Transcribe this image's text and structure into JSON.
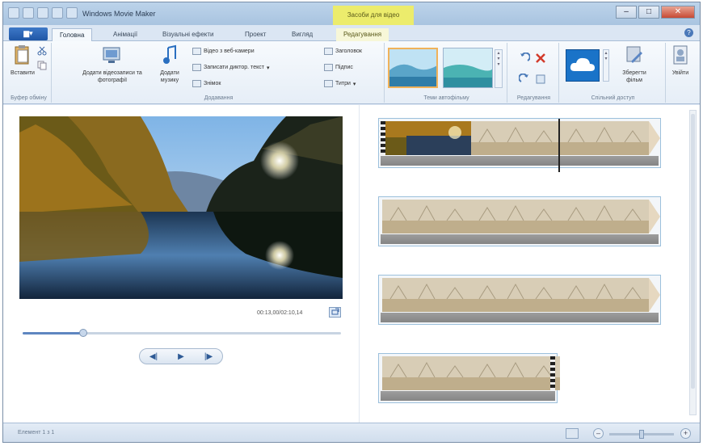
{
  "window": {
    "title": "Windows Movie Maker",
    "context_tab_header": "Засоби для відео",
    "controls": {
      "minimize": "–",
      "maximize": "□",
      "close": "✕"
    }
  },
  "tabs": {
    "file_label": "",
    "items": [
      {
        "label": "Головна",
        "active": true
      },
      {
        "label": "Анімації"
      },
      {
        "label": "Візуальні ефекти"
      },
      {
        "label": "Проект"
      },
      {
        "label": "Вигляд"
      },
      {
        "label": "Редагування",
        "contextual": true
      }
    ],
    "help": "?"
  },
  "ribbon": {
    "clipboard": {
      "paste_label": "Вставити",
      "group_label": "Буфер обміну"
    },
    "add": {
      "add_media_label": "Додати відеозаписи та фотографії",
      "add_music_label": "Додати музику",
      "webcam_label": "Відео з веб-камери",
      "narration_label": "Записати диктор. текст",
      "snapshot_label": "Знімок",
      "title_label": "Заголовок",
      "caption_label": "Підпис",
      "credits_label": "Титри",
      "group_label": "Додавання"
    },
    "themes": {
      "group_label": "Теми автофільму",
      "accent": "#f0b25a"
    },
    "editing": {
      "group_label": "Редагування"
    },
    "share": {
      "group_label": "Спільний доступ",
      "onedrive_icon": "cloud-icon",
      "brand": "#1a73c8"
    },
    "save": {
      "save_movie_label": "Зберегти фільм",
      "signin_label": "Увійти"
    }
  },
  "preview": {
    "timecode": "00:13,00/02:10,14",
    "playback": {
      "progress": 0.19
    }
  },
  "storyboard": {
    "rows": 4,
    "playhead_clip_row": 0
  },
  "status": {
    "text": "Елемент 1 з 1",
    "zoom_level": 0.5
  }
}
